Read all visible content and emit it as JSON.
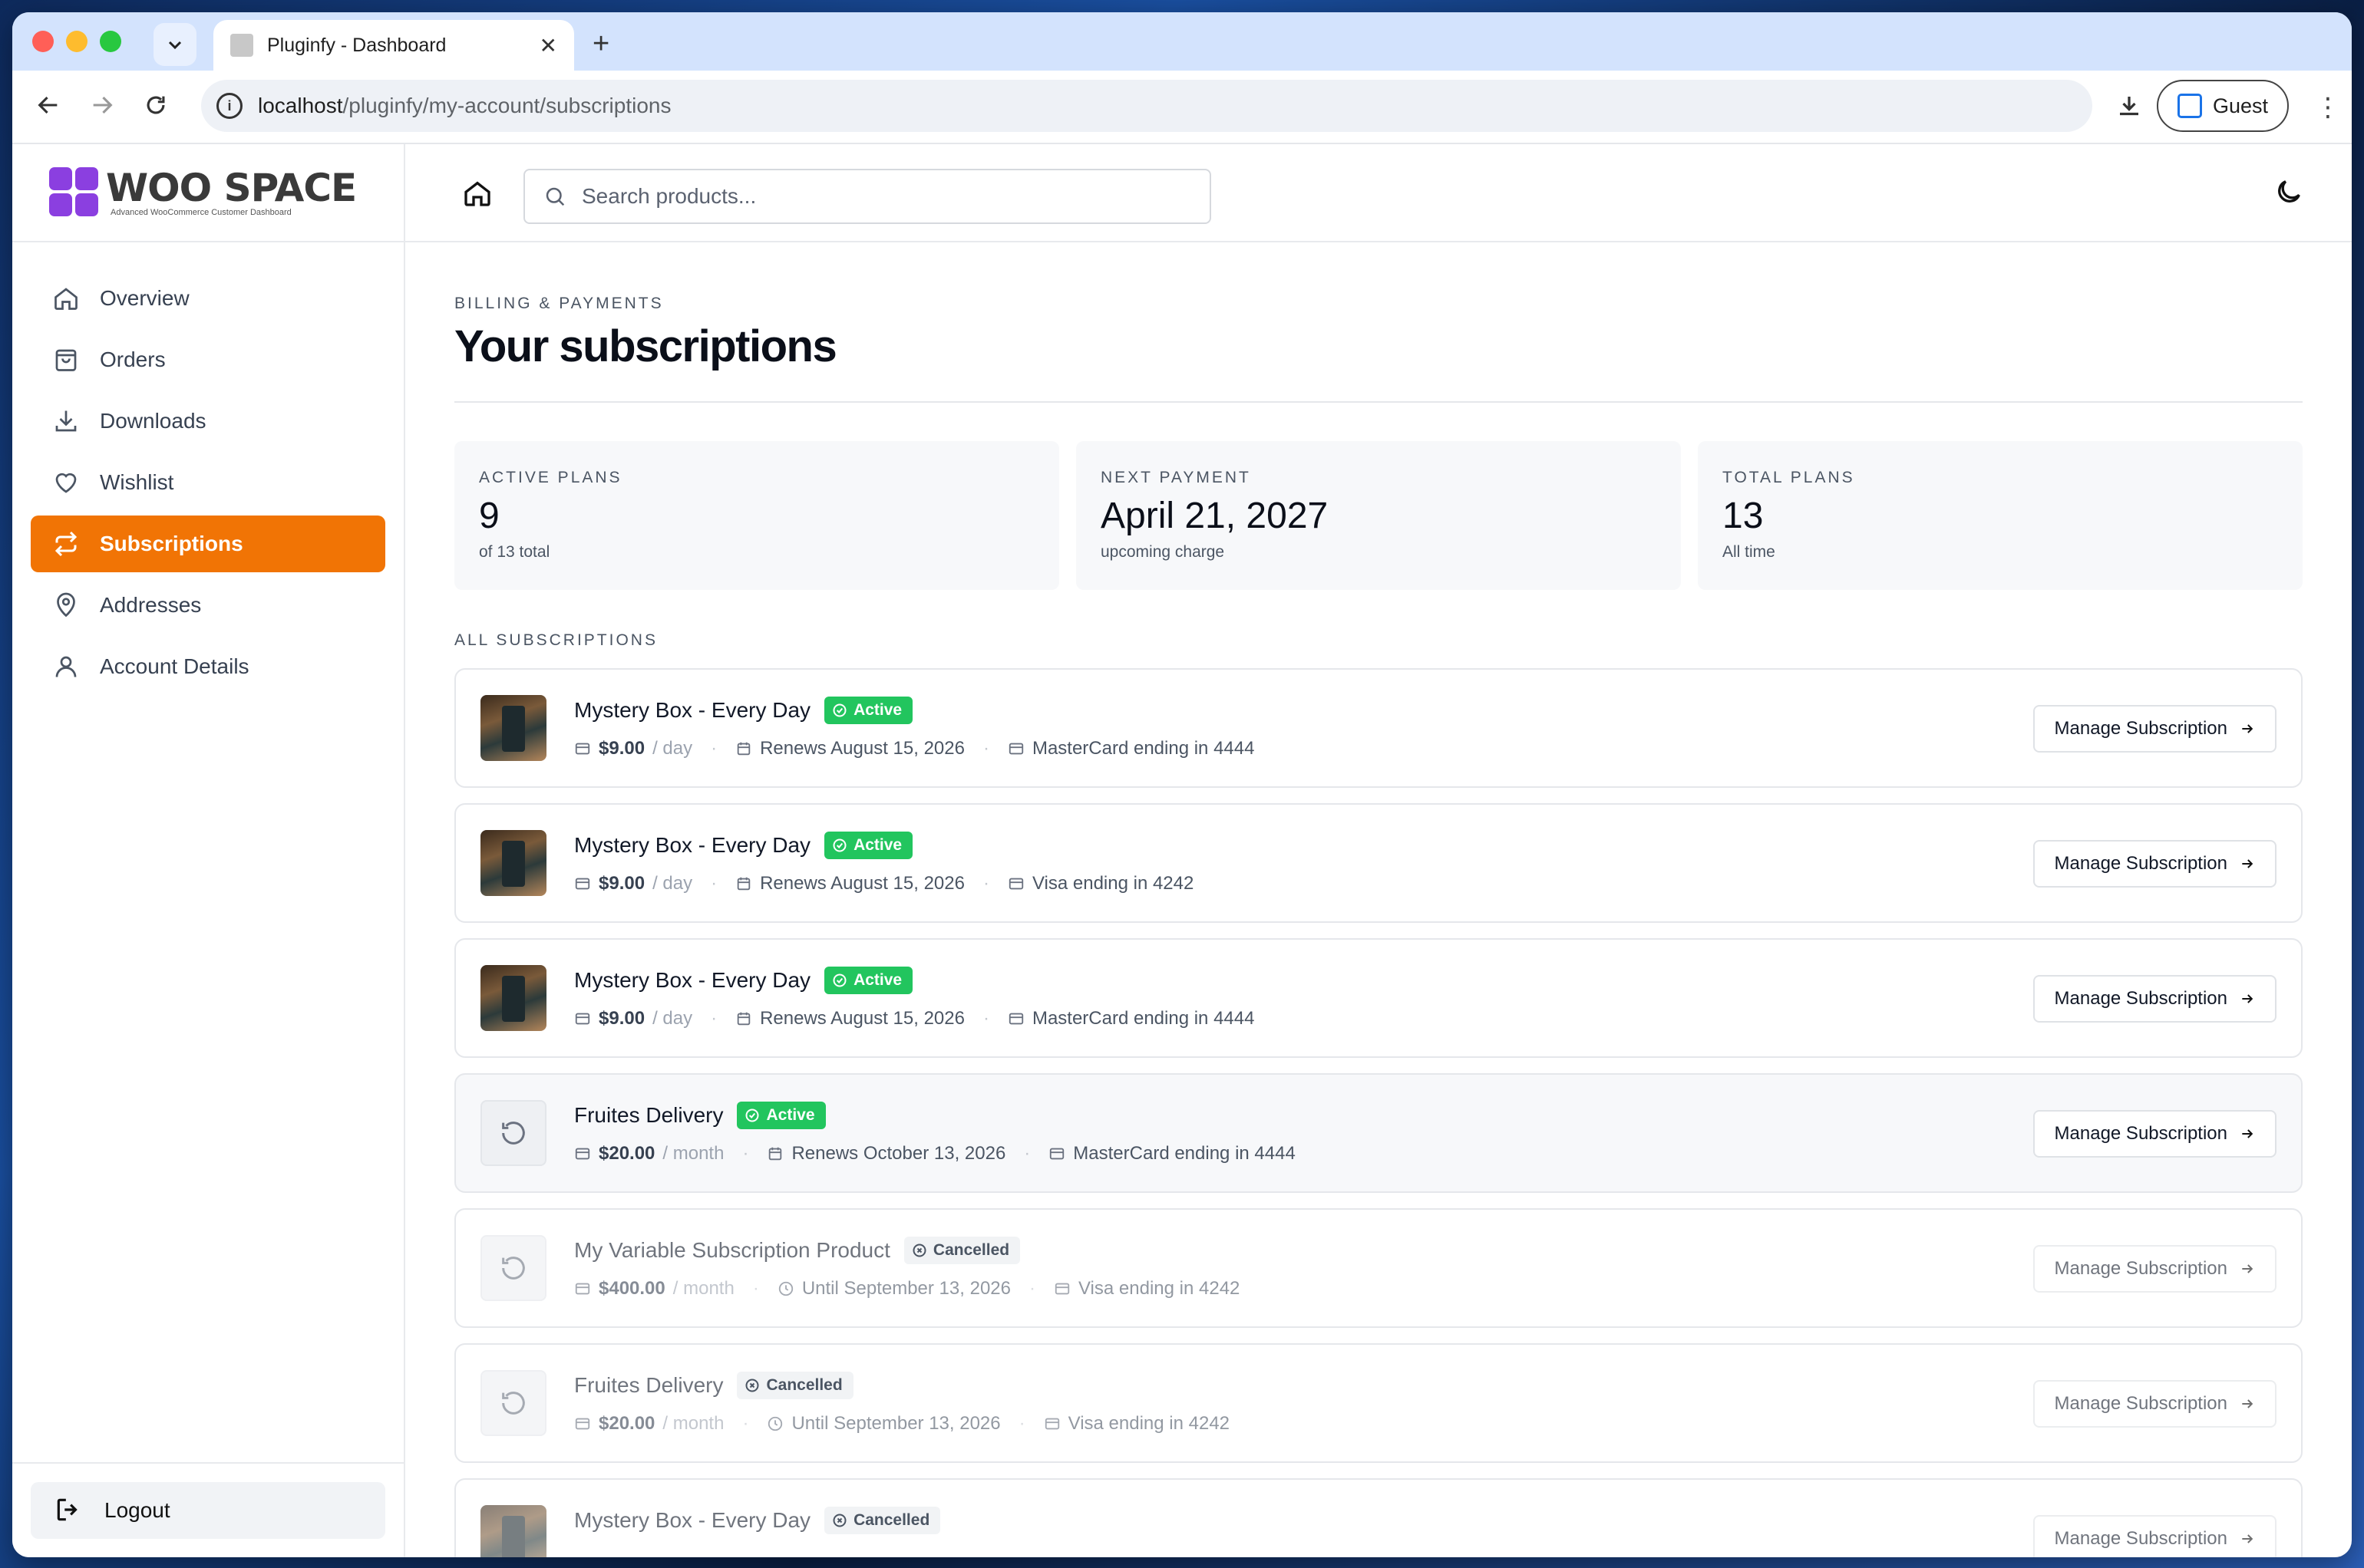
{
  "browser": {
    "tab_title": "Pluginfy - Dashboard",
    "url_host": "localhost",
    "url_path": "/pluginfy/my-account/subscriptions",
    "profile_label": "Guest"
  },
  "brand": {
    "name": "WOO SPACE",
    "tagline": "Advanced WooCommerce Customer Dashboard",
    "logo_color": "#8b3fe0"
  },
  "sidebar": {
    "items": [
      {
        "label": "Overview",
        "icon": "home-icon"
      },
      {
        "label": "Orders",
        "icon": "shopping-bag-icon"
      },
      {
        "label": "Downloads",
        "icon": "download-icon"
      },
      {
        "label": "Wishlist",
        "icon": "heart-icon"
      },
      {
        "label": "Subscriptions",
        "icon": "repeat-icon",
        "active": true
      },
      {
        "label": "Addresses",
        "icon": "map-pin-icon"
      },
      {
        "label": "Account Details",
        "icon": "user-icon"
      }
    ],
    "logout_label": "Logout",
    "accent_color": "#f17405"
  },
  "topbar": {
    "search_placeholder": "Search products..."
  },
  "page": {
    "eyebrow": "BILLING & PAYMENTS",
    "title": "Your subscriptions",
    "section_label": "ALL SUBSCRIPTIONS"
  },
  "stats": [
    {
      "label": "ACTIVE PLANS",
      "value": "9",
      "sub": "of 13 total"
    },
    {
      "label": "NEXT PAYMENT",
      "value": "April 21, 2027",
      "sub": "upcoming charge"
    },
    {
      "label": "TOTAL PLANS",
      "value": "13",
      "sub": "All time"
    }
  ],
  "subscriptions": [
    {
      "name": "Mystery Box - Every Day",
      "status": "Active",
      "price": "$9.00",
      "period": "/ day",
      "date": "Renews August 15, 2026",
      "payment": "MasterCard ending in 4444",
      "thumb": "image",
      "button": "Manage Subscription"
    },
    {
      "name": "Mystery Box - Every Day",
      "status": "Active",
      "price": "$9.00",
      "period": "/ day",
      "date": "Renews August 15, 2026",
      "payment": "Visa ending in 4242",
      "thumb": "image",
      "button": "Manage Subscription"
    },
    {
      "name": "Mystery Box - Every Day",
      "status": "Active",
      "price": "$9.00",
      "period": "/ day",
      "date": "Renews August 15, 2026",
      "payment": "MasterCard ending in 4444",
      "thumb": "image",
      "button": "Manage Subscription"
    },
    {
      "name": "Fruites Delivery",
      "status": "Active",
      "price": "$20.00",
      "period": "/ month",
      "date": "Renews October 13, 2026",
      "payment": "MasterCard ending in 4444",
      "thumb": "icon",
      "button": "Manage Subscription"
    },
    {
      "name": "My Variable Subscription Product",
      "status": "Cancelled",
      "price": "$400.00",
      "period": "/ month",
      "date": "Until September 13, 2026",
      "payment": "Visa ending in 4242",
      "thumb": "icon",
      "button": "Manage Subscription"
    },
    {
      "name": "Fruites Delivery",
      "status": "Cancelled",
      "price": "$20.00",
      "period": "/ month",
      "date": "Until September 13, 2026",
      "payment": "Visa ending in 4242",
      "thumb": "icon",
      "button": "Manage Subscription"
    },
    {
      "name": "Mystery Box - Every Day",
      "status": "Cancelled",
      "price": "$9.00",
      "period": "/ day",
      "date": "",
      "payment": "",
      "thumb": "image",
      "button": "Manage Subscription"
    }
  ],
  "colors": {
    "active_badge": "#22c55e",
    "cancelled_badge": "#f1f3f5"
  }
}
